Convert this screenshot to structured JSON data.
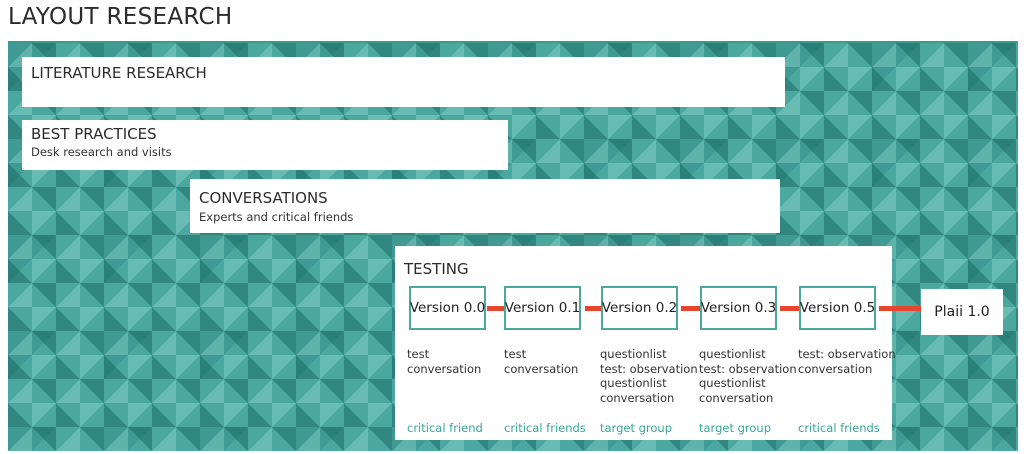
{
  "title": "LAYOUT RESEARCH",
  "literature": {
    "title": "LITERATURE RESEARCH"
  },
  "best_practices": {
    "title": "BEST PRACTICES",
    "subtitle": "Desk research and visits"
  },
  "conversations": {
    "title": "CONVERSATIONS",
    "subtitle": "Experts and critical friends"
  },
  "testing": {
    "title": "TESTING",
    "versions": [
      {
        "label": "Version 0.0",
        "notes": [
          "test",
          "conversation"
        ],
        "audience": "critical friend"
      },
      {
        "label": "Version 0.1",
        "notes": [
          "test",
          "conversation"
        ],
        "audience": "critical friends"
      },
      {
        "label": "Version 0.2",
        "notes": [
          "questionlist",
          "test: observation",
          "questionlist",
          "conversation"
        ],
        "audience": "target group"
      },
      {
        "label": "Version 0.3",
        "notes": [
          "questionlist",
          "test: observation",
          "questionlist",
          "conversation"
        ],
        "audience": "target group"
      },
      {
        "label": "Version 0.5",
        "notes": [
          "test: observation",
          "conversation"
        ],
        "audience": "critical friends"
      }
    ],
    "final": "Plaii 1.0"
  },
  "colors": {
    "teal": "#4aa89f",
    "connector": "#e6452e",
    "audience_text": "#3aa79c"
  }
}
